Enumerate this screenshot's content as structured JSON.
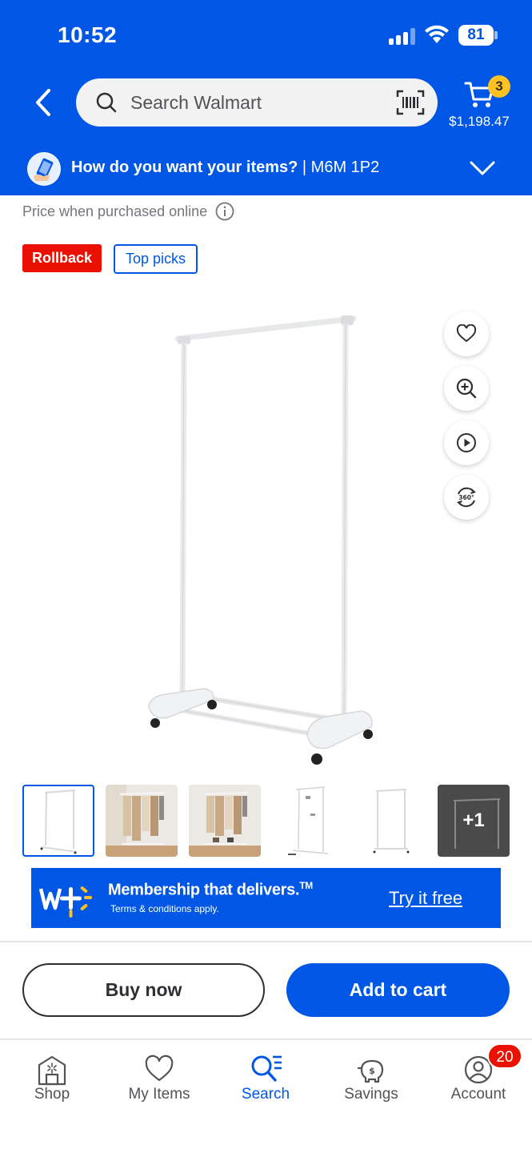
{
  "status_bar": {
    "time": "10:52",
    "battery": "81"
  },
  "header": {
    "search_placeholder": "Search Walmart",
    "cart_count": "3",
    "cart_total": "$1,198.47",
    "delivery_prompt": "How do you want your items?",
    "delivery_postal": " | M6M 1P2"
  },
  "product": {
    "price_note": "Price when purchased online",
    "tags": [
      "Rollback",
      "Top picks"
    ],
    "more_images_label": "+1"
  },
  "promo": {
    "title": "Membership that delivers.",
    "trademark": "TM",
    "terms": "Terms & conditions apply.",
    "cta": "Try it free"
  },
  "actions": {
    "buy_now": "Buy now",
    "add_to_cart": "Add to cart"
  },
  "nav": {
    "items": [
      {
        "label": "Shop",
        "icon": "shop-icon"
      },
      {
        "label": "My Items",
        "icon": "heart-icon"
      },
      {
        "label": "Search",
        "icon": "search-list-icon",
        "active": true
      },
      {
        "label": "Savings",
        "icon": "piggy-bank-icon"
      },
      {
        "label": "Account",
        "icon": "account-icon"
      }
    ],
    "account_badge": "20"
  },
  "colors": {
    "brand_blue": "#0057e5",
    "spark_yellow": "#ffc220",
    "rollback_red": "#ea1100"
  }
}
